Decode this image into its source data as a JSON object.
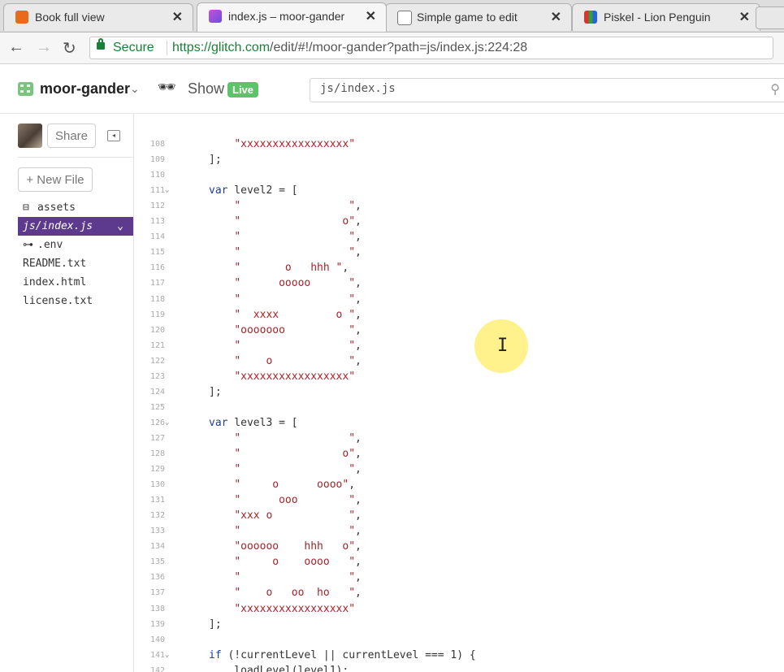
{
  "browser": {
    "tabs": [
      {
        "title": "Book full view",
        "icon": "orange-book-icon",
        "active": false
      },
      {
        "title": "index.js – moor-gander",
        "icon": "glitch-fish-icon",
        "active": true
      },
      {
        "title": "Simple game to edit",
        "icon": "page-icon",
        "active": false
      },
      {
        "title": "Piskel - Lion Penguin",
        "icon": "piskel-grid-icon",
        "active": false
      }
    ],
    "secure_label": "Secure",
    "url_host": "https://glitch.com",
    "url_path": "/edit/#!/moor-gander?path=js/index.js:224:28"
  },
  "header": {
    "project_name": "moor-gander",
    "show_label": "Show",
    "live_badge": "Live",
    "file_search_value": "js/index.js"
  },
  "sidebar": {
    "share_label": "Share",
    "new_file_label": "+ New File",
    "files": [
      {
        "name": "assets",
        "icon": "box-icon"
      },
      {
        "name": "js/index.js",
        "icon": "",
        "active": true
      },
      {
        "name": ".env",
        "icon": "key-icon"
      },
      {
        "name": "README.txt",
        "icon": ""
      },
      {
        "name": "index.html",
        "icon": ""
      },
      {
        "name": "license.txt",
        "icon": ""
      }
    ]
  },
  "editor": {
    "lines": [
      {
        "n": "108",
        "t": "    \"xxxxxxxxxxxxxxxxx\""
      },
      {
        "n": "109",
        "t": "];"
      },
      {
        "n": "110",
        "t": ""
      },
      {
        "n": "111",
        "t": "var level2 = [",
        "fold": true
      },
      {
        "n": "112",
        "t": "    \"                 \","
      },
      {
        "n": "113",
        "t": "    \"                o\","
      },
      {
        "n": "114",
        "t": "    \"                 \","
      },
      {
        "n": "115",
        "t": "    \"                 \","
      },
      {
        "n": "116",
        "t": "    \"       o   hhh \","
      },
      {
        "n": "117",
        "t": "    \"      ooooo      \","
      },
      {
        "n": "118",
        "t": "    \"                 \","
      },
      {
        "n": "119",
        "t": "    \"  xxxx         o \","
      },
      {
        "n": "120",
        "t": "    \"ooooooo          \","
      },
      {
        "n": "121",
        "t": "    \"                 \","
      },
      {
        "n": "122",
        "t": "    \"    o            \","
      },
      {
        "n": "123",
        "t": "    \"xxxxxxxxxxxxxxxxx\""
      },
      {
        "n": "124",
        "t": "];"
      },
      {
        "n": "125",
        "t": ""
      },
      {
        "n": "126",
        "t": "var level3 = [",
        "fold": true
      },
      {
        "n": "127",
        "t": "    \"                 \","
      },
      {
        "n": "128",
        "t": "    \"                o\","
      },
      {
        "n": "129",
        "t": "    \"                 \","
      },
      {
        "n": "130",
        "t": "    \"     o      oooo\","
      },
      {
        "n": "131",
        "t": "    \"      ooo        \","
      },
      {
        "n": "132",
        "t": "    \"xxx o            \","
      },
      {
        "n": "133",
        "t": "    \"                 \","
      },
      {
        "n": "134",
        "t": "    \"oooooo    hhh   o\","
      },
      {
        "n": "135",
        "t": "    \"     o    oooo   \","
      },
      {
        "n": "136",
        "t": "    \"                 \","
      },
      {
        "n": "137",
        "t": "    \"    o   oo  ho   \","
      },
      {
        "n": "138",
        "t": "    \"xxxxxxxxxxxxxxxxx\""
      },
      {
        "n": "139",
        "t": "];"
      },
      {
        "n": "140",
        "t": ""
      },
      {
        "n": "141",
        "t": "if (!currentLevel || currentLevel === 1) {",
        "fold": true
      },
      {
        "n": "142",
        "t": "    loadLevel(level1);"
      }
    ]
  },
  "colors": {
    "accent_purple": "#5d3a8e",
    "live_green": "#5dc36b",
    "secure_green": "#1a7f37",
    "keyword_blue": "#1c3f9a",
    "string_red": "#a5232a"
  }
}
